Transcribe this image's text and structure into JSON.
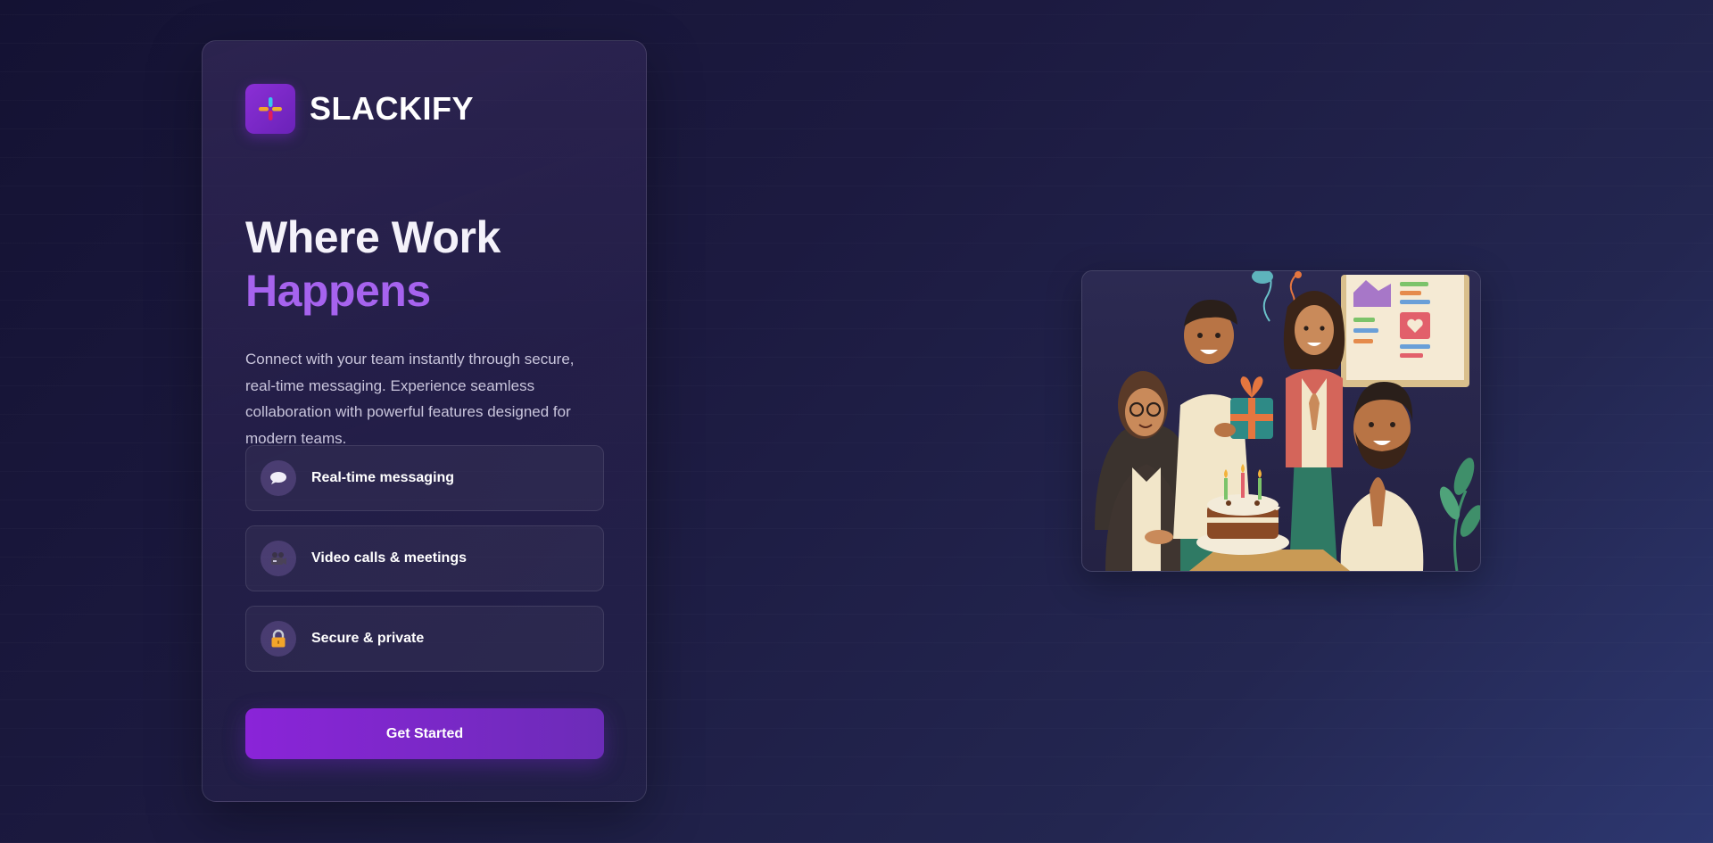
{
  "brand": {
    "name": "SLACKIFY",
    "logo_icon": "slack-style-plus-icon"
  },
  "hero": {
    "headline_line1": "Where Work",
    "headline_line2": "Happens",
    "description": "Connect with your team instantly through secure, real-time messaging. Experience seamless collaboration with powerful features designed for modern teams."
  },
  "features": [
    {
      "icon": "speech-bubble-icon",
      "label": "Real-time messaging"
    },
    {
      "icon": "video-camera-icon",
      "label": "Video calls & meetings"
    },
    {
      "icon": "lock-icon",
      "label": "Secure & private"
    }
  ],
  "cta": {
    "label": "Get Started"
  },
  "illustration": {
    "subject": "team-celebration-illustration"
  },
  "colors": {
    "accent": "#a663ee",
    "button": "#8a24d8",
    "background": "#1c1a40"
  }
}
